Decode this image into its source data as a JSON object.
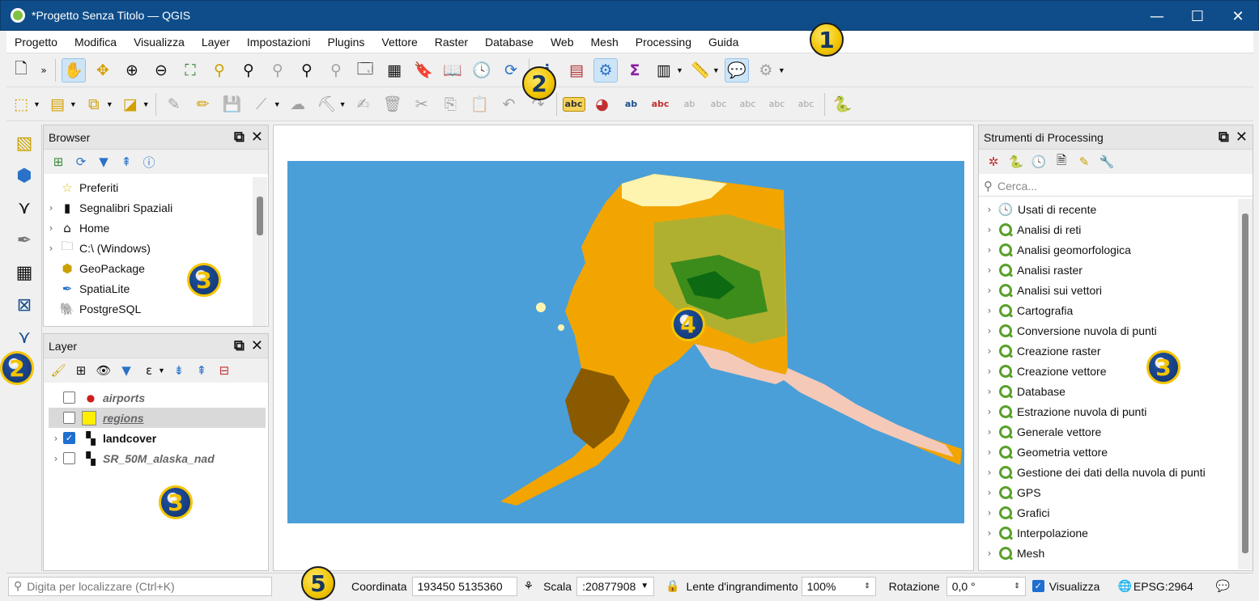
{
  "window": {
    "title": "*Progetto Senza Titolo — QGIS",
    "minimize": "—",
    "maximize": "☐",
    "close": "✕"
  },
  "menu": [
    "Progetto",
    "Modifica",
    "Visualizza",
    "Layer",
    "Impostazioni",
    "Plugins",
    "Vettore",
    "Raster",
    "Database",
    "Web",
    "Mesh",
    "Processing",
    "Guida"
  ],
  "badges": {
    "b1": "1",
    "b2": "2",
    "b3": "3",
    "b4": "4",
    "b5": "5"
  },
  "browser": {
    "title": "Browser",
    "items": [
      {
        "label": "Preferiti",
        "icon": "star-icon",
        "chev": ""
      },
      {
        "label": "Segnalibri Spaziali",
        "icon": "bookmark-icon",
        "chev": "›"
      },
      {
        "label": "Home",
        "icon": "home-icon",
        "chev": "›"
      },
      {
        "label": "C:\\ (Windows)",
        "icon": "folder-icon",
        "chev": "›"
      },
      {
        "label": "GeoPackage",
        "icon": "geopackage-icon",
        "chev": ""
      },
      {
        "label": "SpatiaLite",
        "icon": "spatialite-icon",
        "chev": ""
      },
      {
        "label": "PostgreSQL",
        "icon": "postgresql-icon",
        "chev": ""
      }
    ]
  },
  "layers": {
    "title": "Layer",
    "items": [
      {
        "label": "airports",
        "checked": false,
        "style": "italic"
      },
      {
        "label": "regions",
        "checked": false,
        "style": "italic-underline"
      },
      {
        "label": "landcover",
        "checked": true,
        "style": "bold"
      },
      {
        "label": "SR_50M_alaska_nad",
        "checked": false,
        "style": "italic"
      }
    ]
  },
  "processing": {
    "title": "Strumenti di Processing",
    "search_placeholder": "Cerca...",
    "items": [
      "Usati di recente",
      "Analisi di reti",
      "Analisi geomorfologica",
      "Analisi raster",
      "Analisi sui vettori",
      "Cartografia",
      "Conversione nuvola di punti",
      "Creazione raster",
      "Creazione vettore",
      "Database",
      "Estrazione nuvola di punti",
      "Generale vettore",
      "Geometria vettore",
      "Gestione dei dati della nuvola di punti",
      "GPS",
      "Grafici",
      "Interpolazione",
      "Mesh"
    ]
  },
  "status": {
    "locator_placeholder": "Digita per localizzare (Ctrl+K)",
    "coord_label": "Coordinata",
    "coord_value": "193450  5135360",
    "scale_label": "Scala",
    "scale_value": ":20877908",
    "magnifier_label": "Lente d'ingrandimento",
    "magnifier_value": "100%",
    "rotation_label": "Rotazione",
    "rotation_value": "0,0 °",
    "render_label": "Visualizza",
    "crs": "EPSG:2964"
  },
  "colors": {
    "titlebar": "#0f4d8a",
    "ocean": "#4a9fd8",
    "badge_yellow": "#f1c400",
    "badge_blue": "#163c7a"
  }
}
